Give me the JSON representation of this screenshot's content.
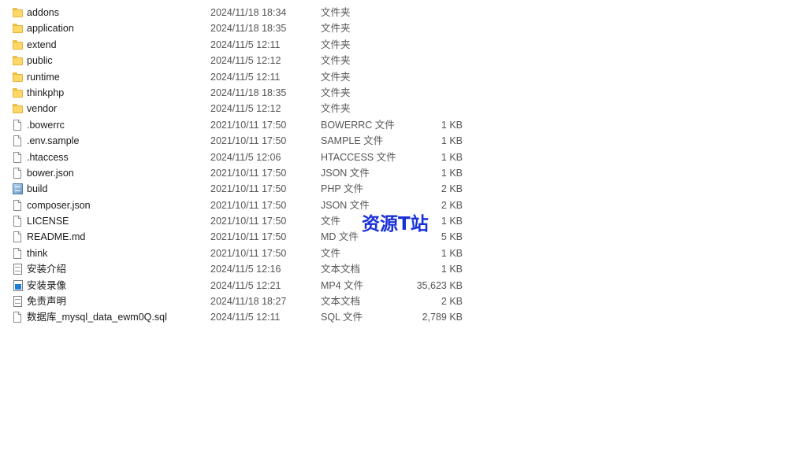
{
  "files": [
    {
      "name": "addons",
      "date": "2024/11/18 18:34",
      "type": "文件夹",
      "size": "",
      "icon": "folder-icon"
    },
    {
      "name": "application",
      "date": "2024/11/18 18:35",
      "type": "文件夹",
      "size": "",
      "icon": "folder-icon"
    },
    {
      "name": "extend",
      "date": "2024/11/5 12:11",
      "type": "文件夹",
      "size": "",
      "icon": "folder-icon"
    },
    {
      "name": "public",
      "date": "2024/11/5 12:12",
      "type": "文件夹",
      "size": "",
      "icon": "folder-icon"
    },
    {
      "name": "runtime",
      "date": "2024/11/5 12:11",
      "type": "文件夹",
      "size": "",
      "icon": "folder-icon"
    },
    {
      "name": "thinkphp",
      "date": "2024/11/18 18:35",
      "type": "文件夹",
      "size": "",
      "icon": "folder-icon"
    },
    {
      "name": "vendor",
      "date": "2024/11/5 12:12",
      "type": "文件夹",
      "size": "",
      "icon": "folder-icon"
    },
    {
      "name": ".bowerrc",
      "date": "2021/10/11 17:50",
      "type": "BOWERRC 文件",
      "size": "1 KB",
      "icon": "file-icon"
    },
    {
      "name": ".env.sample",
      "date": "2021/10/11 17:50",
      "type": "SAMPLE 文件",
      "size": "1 KB",
      "icon": "file-icon"
    },
    {
      "name": ".htaccess",
      "date": "2024/11/5 12:06",
      "type": "HTACCESS 文件",
      "size": "1 KB",
      "icon": "file-icon"
    },
    {
      "name": "bower.json",
      "date": "2021/10/11 17:50",
      "type": "JSON 文件",
      "size": "1 KB",
      "icon": "file-icon"
    },
    {
      "name": "build",
      "date": "2021/10/11 17:50",
      "type": "PHP 文件",
      "size": "2 KB",
      "icon": "php-file-icon"
    },
    {
      "name": "composer.json",
      "date": "2021/10/11 17:50",
      "type": "JSON 文件",
      "size": "2 KB",
      "icon": "file-icon"
    },
    {
      "name": "LICENSE",
      "date": "2021/10/11 17:50",
      "type": "文件",
      "size": "1 KB",
      "icon": "file-icon"
    },
    {
      "name": "README.md",
      "date": "2021/10/11 17:50",
      "type": "MD 文件",
      "size": "5 KB",
      "icon": "file-icon"
    },
    {
      "name": "think",
      "date": "2021/10/11 17:50",
      "type": "文件",
      "size": "1 KB",
      "icon": "file-icon"
    },
    {
      "name": "安装介绍",
      "date": "2024/11/5 12:16",
      "type": "文本文档",
      "size": "1 KB",
      "icon": "text-document-icon"
    },
    {
      "name": "安装录像",
      "date": "2024/11/5 12:21",
      "type": "MP4 文件",
      "size": "35,623 KB",
      "icon": "video-file-icon"
    },
    {
      "name": "免责声明",
      "date": "2024/11/18 18:27",
      "type": "文本文档",
      "size": "2 KB",
      "icon": "text-document-icon"
    },
    {
      "name": "数据库_mysql_data_ewm0Q.sql",
      "date": "2024/11/5 12:11",
      "type": "SQL 文件",
      "size": "2,789 KB",
      "icon": "file-icon"
    }
  ],
  "watermark": {
    "text": "资源T站",
    "color": "#1830d8"
  },
  "colors": {
    "folder": "#ffd766",
    "background": "#ffffff"
  }
}
